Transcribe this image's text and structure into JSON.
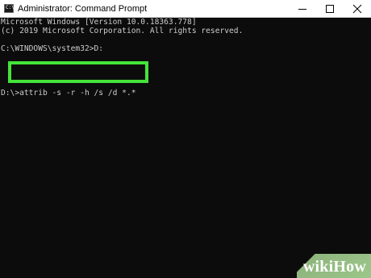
{
  "window": {
    "title": "Administrator: Command Prompt",
    "icon": "cmd-icon",
    "icon_glyph": "C:\\",
    "controls": {
      "minimize": "minimize-icon",
      "maximize": "maximize-icon",
      "close": "close-icon"
    }
  },
  "console": {
    "lines": [
      "Microsoft Windows [Version 10.0.18363.778]",
      "(c) 2019 Microsoft Corporation. All rights reserved.",
      "C:\\WINDOWS\\system32>D:",
      "D:\\>attrib -s -r -h /s /d *.*"
    ],
    "text_color": "#cccccc",
    "background": "#0c0c0c"
  },
  "highlight": {
    "color": "#44e33a"
  },
  "watermark": {
    "text_a": "wiki",
    "text_b": "How",
    "color": "#9cc68a"
  }
}
